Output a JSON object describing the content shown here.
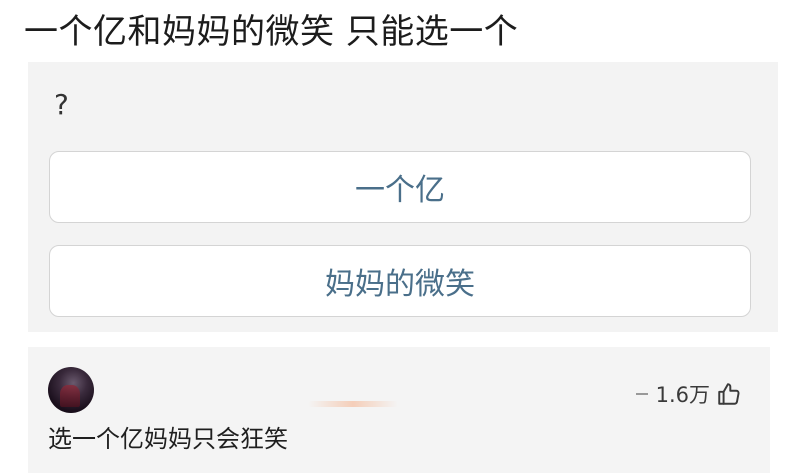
{
  "question": {
    "title": "一个亿和妈妈的微笑 只能选一个"
  },
  "poll": {
    "prompt": "?",
    "options": [
      {
        "label": "一个亿"
      },
      {
        "label": "妈妈的微笑"
      }
    ]
  },
  "comment": {
    "avatar_icon": "avatar",
    "like_count": "1.6万",
    "like_icon": "thumbs-up-icon",
    "text": "选一个亿妈妈只会狂笑"
  },
  "colors": {
    "option_text": "#4a6f8a",
    "poll_background": "#f3f3f3",
    "comment_background": "#f4f4f4"
  }
}
